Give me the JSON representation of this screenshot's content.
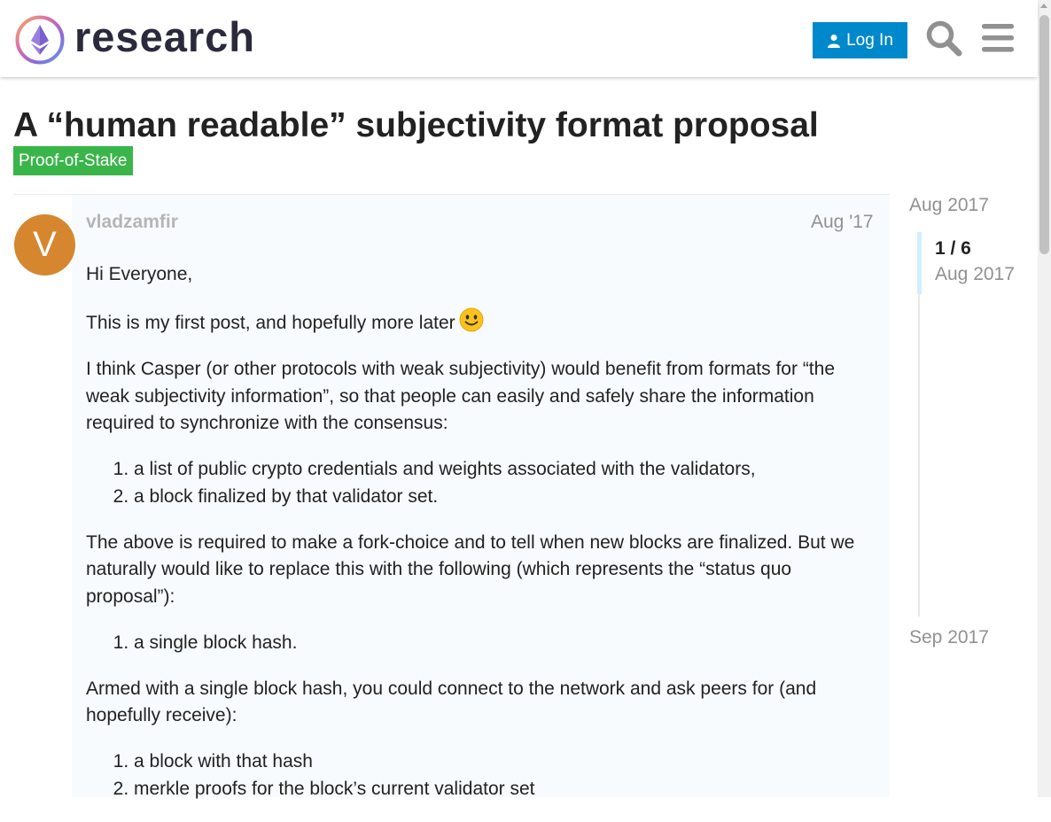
{
  "header": {
    "brand": "research",
    "login_label": "Log In"
  },
  "topic": {
    "title": "A “human readable” subjectivity format proposal",
    "category": "Proof-of-Stake",
    "category_color": "#3ab54a"
  },
  "post": {
    "avatar_letter": "V",
    "avatar_color": "#d6862e",
    "username": "vladzamfir",
    "date": "Aug '17",
    "p1": "Hi Everyone,",
    "p2": "This is my first post, and hopefully more later",
    "p3": "I think Casper (or other protocols with weak subjectivity) would benefit from formats for “the weak subjectivity information”, so that people can easily and safely share the information required to synchronize with the consensus:",
    "list1": [
      "a list of public crypto credentials and weights associated with the validators,",
      "a block finalized by that validator set."
    ],
    "p4": "The above is required to make a fork-choice and to tell when new blocks are finalized. But we naturally would like to replace this with the following (which represents the “status quo proposal”):",
    "list2": [
      "a single block hash."
    ],
    "p5": "Armed with a single block hash, you could connect to the network and ask peers for (and hopefully receive):",
    "list3": [
      "a block with that hash",
      "merkle proofs for the block’s current validator set"
    ]
  },
  "timeline": {
    "start": "Aug 2017",
    "position": "1 / 6",
    "position_date": "Aug 2017",
    "end": "Sep 2017"
  },
  "colors": {
    "accent": "#0088cc",
    "timeline_handle": "#d1f0ff"
  }
}
